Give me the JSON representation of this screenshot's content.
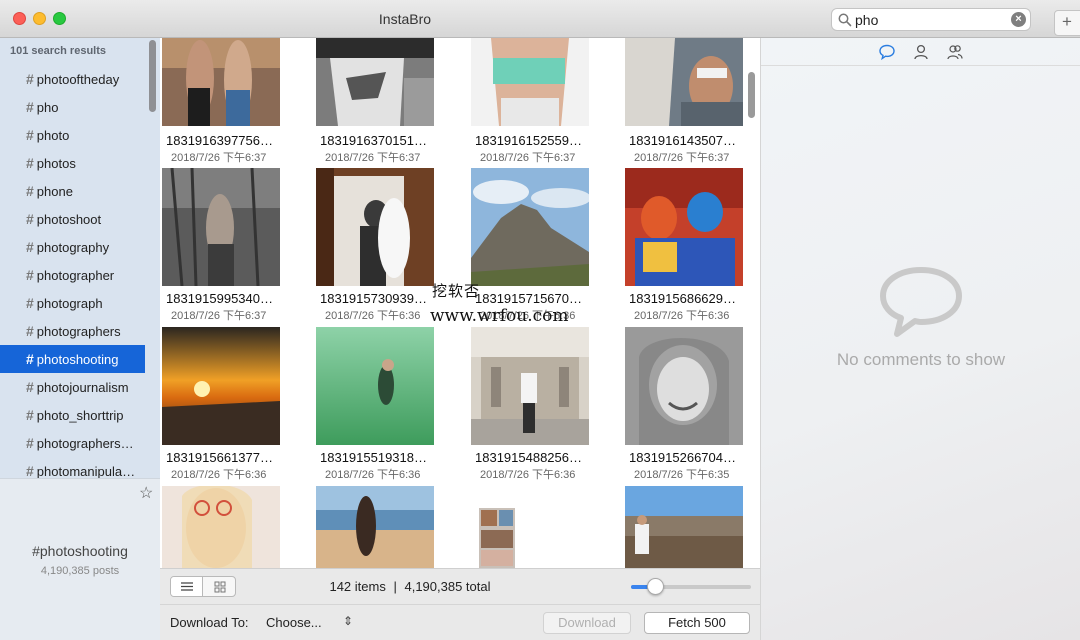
{
  "window": {
    "title": "InstaBro"
  },
  "search": {
    "value": "pho",
    "placeholder": ""
  },
  "sidebar": {
    "header": "101 search results",
    "items": [
      {
        "label": "photooftheday"
      },
      {
        "label": "pho"
      },
      {
        "label": "photo"
      },
      {
        "label": "photos"
      },
      {
        "label": "phone"
      },
      {
        "label": "photoshoot"
      },
      {
        "label": "photography"
      },
      {
        "label": "photographer"
      },
      {
        "label": "photograph"
      },
      {
        "label": "photographers"
      },
      {
        "label": "photoshooting",
        "selected": true
      },
      {
        "label": "photojournalism"
      },
      {
        "label": "photo_shorttrip"
      },
      {
        "label": "photographers…"
      },
      {
        "label": "photomanipula…"
      }
    ],
    "selected_tag": "#photoshooting",
    "selected_posts": "4,190,385 posts"
  },
  "grid": {
    "posts": [
      {
        "id": "1831916397756…",
        "date": "2018/7/26 下午6:37"
      },
      {
        "id": "1831916370151…",
        "date": "2018/7/26 下午6:37"
      },
      {
        "id": "1831916152559…",
        "date": "2018/7/26 下午6:37"
      },
      {
        "id": "1831916143507…",
        "date": "2018/7/26 下午6:37"
      },
      {
        "id": "1831915995340…",
        "date": "2018/7/26 下午6:37"
      },
      {
        "id": "1831915730939…",
        "date": "2018/7/26 下午6:36"
      },
      {
        "id": "1831915715670…",
        "date": "2018/7/26 下午6:36"
      },
      {
        "id": "1831915686629…",
        "date": "2018/7/26 下午6:36"
      },
      {
        "id": "1831915661377…",
        "date": "2018/7/26 下午6:36"
      },
      {
        "id": "1831915519318…",
        "date": "2018/7/26 下午6:36"
      },
      {
        "id": "1831915488256…",
        "date": "2018/7/26 下午6:36"
      },
      {
        "id": "1831915266704…",
        "date": "2018/7/26 下午6:35"
      },
      {
        "id": "",
        "date": ""
      },
      {
        "id": "",
        "date": ""
      },
      {
        "id": "",
        "date": ""
      },
      {
        "id": "",
        "date": ""
      }
    ]
  },
  "footer": {
    "items_count": "142 items",
    "separator": "|",
    "total": "4,190,385 total",
    "zoom_level": 0.2,
    "download_to_label": "Download To:",
    "download_to_value": "Choose...",
    "download_button": "Download",
    "fetch_button": "Fetch 500"
  },
  "comments": {
    "empty_text": "No comments to show"
  },
  "watermark": {
    "line1": "挖软否",
    "line2": "www.wrfou.com"
  },
  "colors": {
    "accent": "#1665d8",
    "sidebar_bg": "#d9e3ef"
  }
}
